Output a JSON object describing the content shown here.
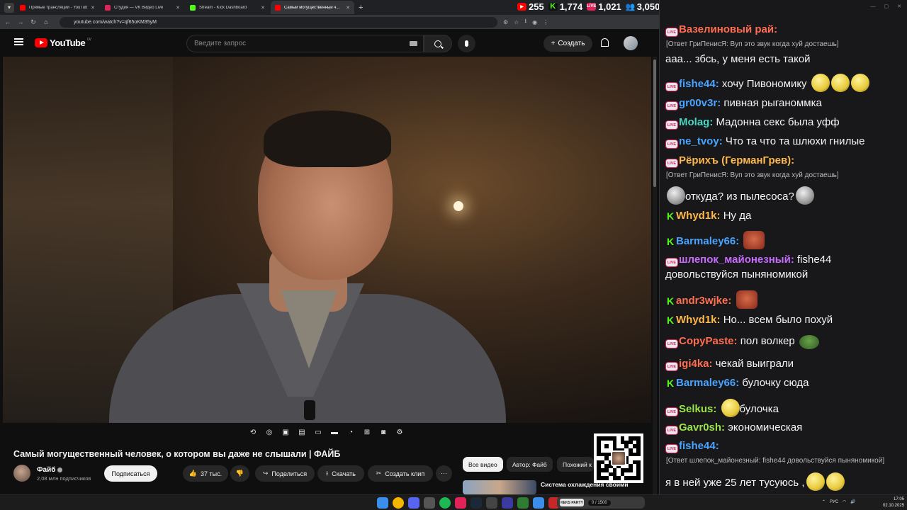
{
  "browser": {
    "tabs": [
      {
        "title": "Прямые трансляции - YouTube",
        "favicon_color": "#ff0000"
      },
      {
        "title": "Студия — VK Видео Live",
        "favicon_color": "#e0245a"
      },
      {
        "title": "Stream - Kick Dashboard",
        "favicon_color": "#53fc18"
      },
      {
        "title": "Самый могущественный ч...",
        "favicon_color": "#ff0000"
      }
    ],
    "url": "youtube.com/watch?v=qf65oKM35yM"
  },
  "counters": [
    {
      "platform": "youtube",
      "value": "255",
      "color": "#ff0000"
    },
    {
      "platform": "kick",
      "value": "1,774",
      "color": "#53fc18"
    },
    {
      "platform": "vk-live",
      "value": "1,021",
      "color": "#e0245a"
    },
    {
      "platform": "total",
      "value": "3,050",
      "color": "#4a8be0"
    }
  ],
  "youtube": {
    "logo_text": "YouTube",
    "region": "LV",
    "search_placeholder": "Введите запрос",
    "create_label": "Создать",
    "video_title": "Самый могущественный человек, о котором вы даже не слышали | ФАЙБ",
    "channel_name": "Файб",
    "channel_subs": "2,08 млн подписчиков",
    "subscribe_label": "Подписаться",
    "likes": "37 тыс.",
    "share_label": "Поделиться",
    "download_label": "Скачать",
    "clip_label": "Создать клип",
    "chips": [
      "Все видео",
      "Автор: Файб",
      "Похожий к"
    ],
    "related_title": "Система охлаждения своими"
  },
  "chat": {
    "messages": [
      {
        "badge": "live",
        "nick": "Вазелиновый рай:",
        "nick_color": "#ff6e50",
        "reply": "[Ответ ГриПенисЯ: Вуп это звук когда хуй достаешь]",
        "text": "ааа... збсь, у меня есть такой"
      },
      {
        "badge": "live",
        "nick": "fishe44:",
        "nick_color": "#4aa3ff",
        "text": "хочу Пивономику"
      },
      {
        "badge": "live",
        "nick": "gr00v3r:",
        "nick_color": "#4aa3ff",
        "text": "пивная рыганоммка"
      },
      {
        "badge": "live",
        "nick": "Molag:",
        "nick_color": "#4ad6c3",
        "text": "Мадонна секс была уфф"
      },
      {
        "badge": "live",
        "nick": "ne_tvoy:",
        "nick_color": "#4aa3ff",
        "text": "Что та что та шлюхи гнилые"
      },
      {
        "badge": "live",
        "nick": "Рёрихъ (ГерманГрев):",
        "nick_color": "#ffb84a",
        "reply": "[Ответ ГриПенисЯ: Вуп это звук когда хуй достаешь]",
        "text": "откуда? из пылесоса?"
      },
      {
        "badge": "kick",
        "nick": "Whyd1k:",
        "nick_color": "#ffb84a",
        "text": "Ну да"
      },
      {
        "badge": "kick",
        "nick": "Barmaley66:",
        "nick_color": "#4aa3ff",
        "text": ""
      },
      {
        "badge": "live",
        "nick": "шлепок_майонезный:",
        "nick_color": "#c86aff",
        "text": "fishe44",
        "text2": "довольствуйся пыняномикой"
      },
      {
        "badge": "kick",
        "nick": "andr3wjke:",
        "nick_color": "#ff6e50",
        "text": ""
      },
      {
        "badge": "kick",
        "nick": "Whyd1k:",
        "nick_color": "#ffb84a",
        "text": "Но... всем было похуй"
      },
      {
        "badge": "live",
        "nick": "CopyPaste:",
        "nick_color": "#ff6e50",
        "text": "пол волкер"
      },
      {
        "badge": "live",
        "nick": "igi4ka:",
        "nick_color": "#ff6e50",
        "text": "чекай выиграли"
      },
      {
        "badge": "kick",
        "nick": "Barmaley66:",
        "nick_color": "#4aa3ff",
        "text": "булочку сюда"
      },
      {
        "badge": "live",
        "nick": "Selkus:",
        "nick_color": "#9ae34a",
        "text": "булочка"
      },
      {
        "badge": "live",
        "nick": "Gavr0sh:",
        "nick_color": "#9ae34a",
        "text": "экономическая"
      },
      {
        "badge": "live",
        "nick": "fishe44:",
        "nick_color": "#4aa3ff",
        "reply": "[Ответ шлепок_майонезный: fishe44 довольствуйся пыняномикой]",
        "text": "я в ней уже 25 лет тусуюсь ,"
      }
    ]
  },
  "taskbar": {
    "tray_lang": "РУС",
    "time": "17:05",
    "date": "02.10.2025",
    "overlay_logo": "KEKS PARTY",
    "overlay_count": "0 / 1500"
  }
}
